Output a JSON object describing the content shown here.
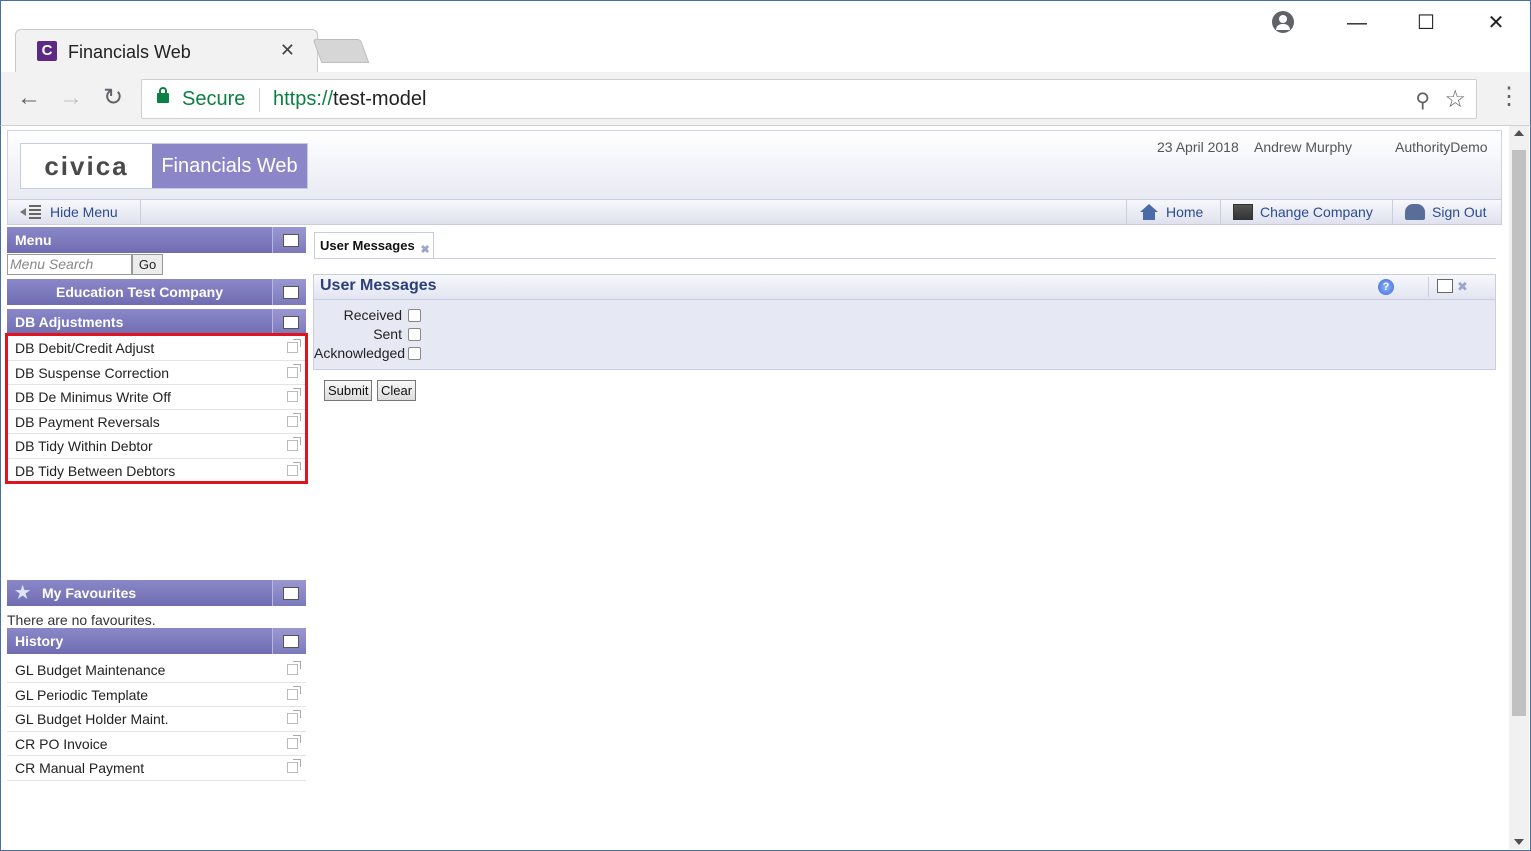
{
  "browser": {
    "tab_title": "Financials Web",
    "favicon_letter": "C",
    "secure_label": "Secure",
    "url_scheme": "https://",
    "url_host": "test-model"
  },
  "header": {
    "logo_text": "civica",
    "product_name": "Financials Web",
    "date": "23 April 2018",
    "user": "Andrew Murphy",
    "authority": "AuthorityDemo"
  },
  "header_bar": {
    "hide_menu": "Hide Menu",
    "home": "Home",
    "change_company": "Change Company",
    "sign_out": "Sign Out"
  },
  "sidebar": {
    "menu_title": "Menu",
    "search_placeholder": "Menu Search",
    "go_label": "Go",
    "company": "Education Test Company",
    "section_title": "DB Adjustments",
    "section_items": [
      "DB Debit/Credit Adjust",
      "DB Suspense Correction",
      "DB De Minimus Write Off",
      "DB Payment Reversals",
      "DB Tidy Within Debtor",
      "DB Tidy Between Debtors"
    ],
    "favourites_title": "My Favourites",
    "favourites_empty": "There are no favourites.",
    "history_title": "History",
    "history_items": [
      "GL Budget Maintenance",
      "GL Periodic Template",
      "GL Budget Holder Maint.",
      "CR PO Invoice",
      "CR Manual Payment"
    ]
  },
  "main": {
    "tab_label": "User Messages",
    "panel_title": "User Messages",
    "filters": [
      "Received",
      "Sent",
      "Acknowledged"
    ],
    "submit_label": "Submit",
    "clear_label": "Clear"
  },
  "colors": {
    "panel_header": "#7c79bc",
    "highlight": "#e0131e",
    "secure_green": "#0b8043",
    "link_blue": "#2d4b8f"
  }
}
